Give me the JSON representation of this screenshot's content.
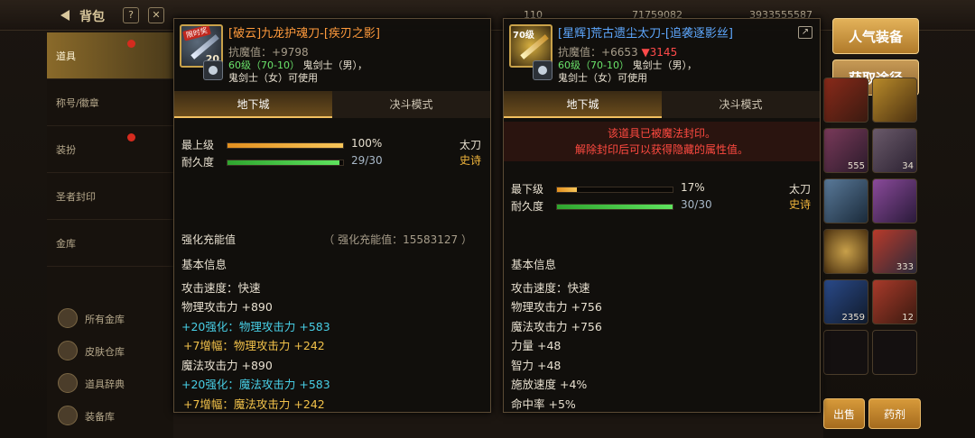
{
  "topbar": {
    "title": "背包",
    "icons": [
      "question-icon",
      "close-icon"
    ],
    "currencies": [
      "110",
      "71759082",
      "3933555587"
    ]
  },
  "sidebar": {
    "items": [
      {
        "label": "道具",
        "active": true,
        "dot": true
      },
      {
        "label": "称号/徽章",
        "active": false,
        "dot": false
      },
      {
        "label": "装扮",
        "active": false,
        "dot": true
      },
      {
        "label": "圣者封印",
        "active": false,
        "dot": false
      },
      {
        "label": "金库",
        "active": false,
        "dot": false
      }
    ],
    "sub_items": [
      "所有金库",
      "皮肤仓库",
      "道具辞典",
      "装备库"
    ]
  },
  "right_buttons": {
    "popular": "人气装备",
    "obtain": "获取途径"
  },
  "inventory_counts": [
    "555",
    "34",
    "333",
    "2359",
    "12"
  ],
  "bottom_buttons": {
    "sell": "出售",
    "medicine": "药剂"
  },
  "left_card": {
    "icon_tag": "限时奖",
    "icon_level": "20",
    "name": "[破云]九龙护魂刀-[疾刃之影]",
    "resist_label": "抗魔值：",
    "resist_value": "+9798",
    "level_range": "60级（70-10）",
    "job_male": "鬼剑士（男），",
    "job_female": "鬼剑士（女）可使用",
    "tab_dungeon": "地下城",
    "tab_pvp": "决斗模式",
    "bars": [
      {
        "label": "最上级",
        "value": "100%",
        "fraction": 1.0,
        "color": "orange"
      },
      {
        "label": "耐久度",
        "value": "29/30",
        "fraction": 0.9667,
        "color": "green"
      }
    ],
    "weapon_type": "太刀",
    "rarity": "史诗",
    "enhance_label": "强化充能值",
    "enhance_value": "（ 强化充能值：15583127 ）",
    "info_title": "基本信息",
    "stats": [
      {
        "text": "攻击速度：快速",
        "color": "w"
      },
      {
        "text": "物理攻击力 +890",
        "color": "w"
      },
      {
        "text": "+20强化：物理攻击力 +583",
        "color": "c"
      },
      {
        "text": "+7增幅：物理攻击力 +242",
        "color": "y"
      },
      {
        "text": "魔法攻击力 +890",
        "color": "w"
      },
      {
        "text": "+20强化：魔法攻击力 +583",
        "color": "c"
      },
      {
        "text": "+7增幅：魔法攻击力 +242",
        "color": "y"
      }
    ]
  },
  "right_card": {
    "icon_level": "70级",
    "name": "[星辉]荒古遗尘太刀-[追袭逐影丝]",
    "resist_label": "抗魔值：",
    "resist_value": "+6653",
    "resist_down": "▼3145",
    "level_range": "60级（70-10）",
    "job_male": "鬼剑士（男），",
    "job_female": "鬼剑士（女）可使用",
    "tab_dungeon": "地下城",
    "tab_pvp": "决斗模式",
    "seal_line1": "该道具已被魔法封印。",
    "seal_line2": "解除封印后可以获得隐藏的属性值。",
    "bars": [
      {
        "label": "最下级",
        "value": "17%",
        "fraction": 0.17,
        "color": "orange"
      },
      {
        "label": "耐久度",
        "value": "30/30",
        "fraction": 1.0,
        "color": "green"
      }
    ],
    "weapon_type": "太刀",
    "rarity": "史诗",
    "info_title": "基本信息",
    "stats": [
      {
        "text": "攻击速度：快速",
        "color": "w"
      },
      {
        "text": "物理攻击力 +756",
        "color": "w"
      },
      {
        "text": "魔法攻击力 +756",
        "color": "w"
      },
      {
        "text": "力量 +48",
        "color": "w"
      },
      {
        "text": "智力 +48",
        "color": "w"
      },
      {
        "text": "施放速度 +4%",
        "color": "w"
      },
      {
        "text": "命中率 +5%",
        "color": "w"
      }
    ]
  }
}
